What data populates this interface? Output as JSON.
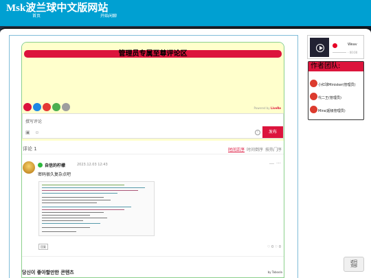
{
  "site": {
    "title": "Msk波兰球中文版网站"
  },
  "nav": {
    "home": "首页",
    "chat": "开始闲聊"
  },
  "banner": {
    "text": "管理员专属至尊评论区"
  },
  "powered_by": {
    "prefix": "Powered by ",
    "brand": "LiveRe"
  },
  "editor": {
    "placeholder": "撰写评论",
    "publish_label": "发布"
  },
  "comments": {
    "count_label": "评论 1",
    "sort": {
      "newest": "时间正序",
      "oldest": "时间倒序",
      "popular": "按热门序"
    }
  },
  "comment": {
    "username": "自信的柠檬",
    "timestamp": "2023.12.03 12:43",
    "text": "密码很久复杂点吧",
    "reply_label": "回复",
    "likes": "0",
    "dislikes": "0"
  },
  "taboola": {
    "heading": "당신이 좋아할만한 콘텐츠",
    "by": "by Taboola"
  },
  "music": {
    "song": "Weav",
    "time": "- 00:00"
  },
  "team": {
    "title": "作者团队:",
    "members": [
      {
        "name": "小红球Minisker(管理员)"
      },
      {
        "name": "代二王(管理员)"
      },
      {
        "name": "Mira(超级管理员)"
      }
    ]
  },
  "back_to_top": {
    "label1": "返回",
    "label2": "顶部"
  },
  "colors": {
    "header": "#00a0d2",
    "accent": "#dc143c",
    "yellow": "#ffffcc"
  }
}
